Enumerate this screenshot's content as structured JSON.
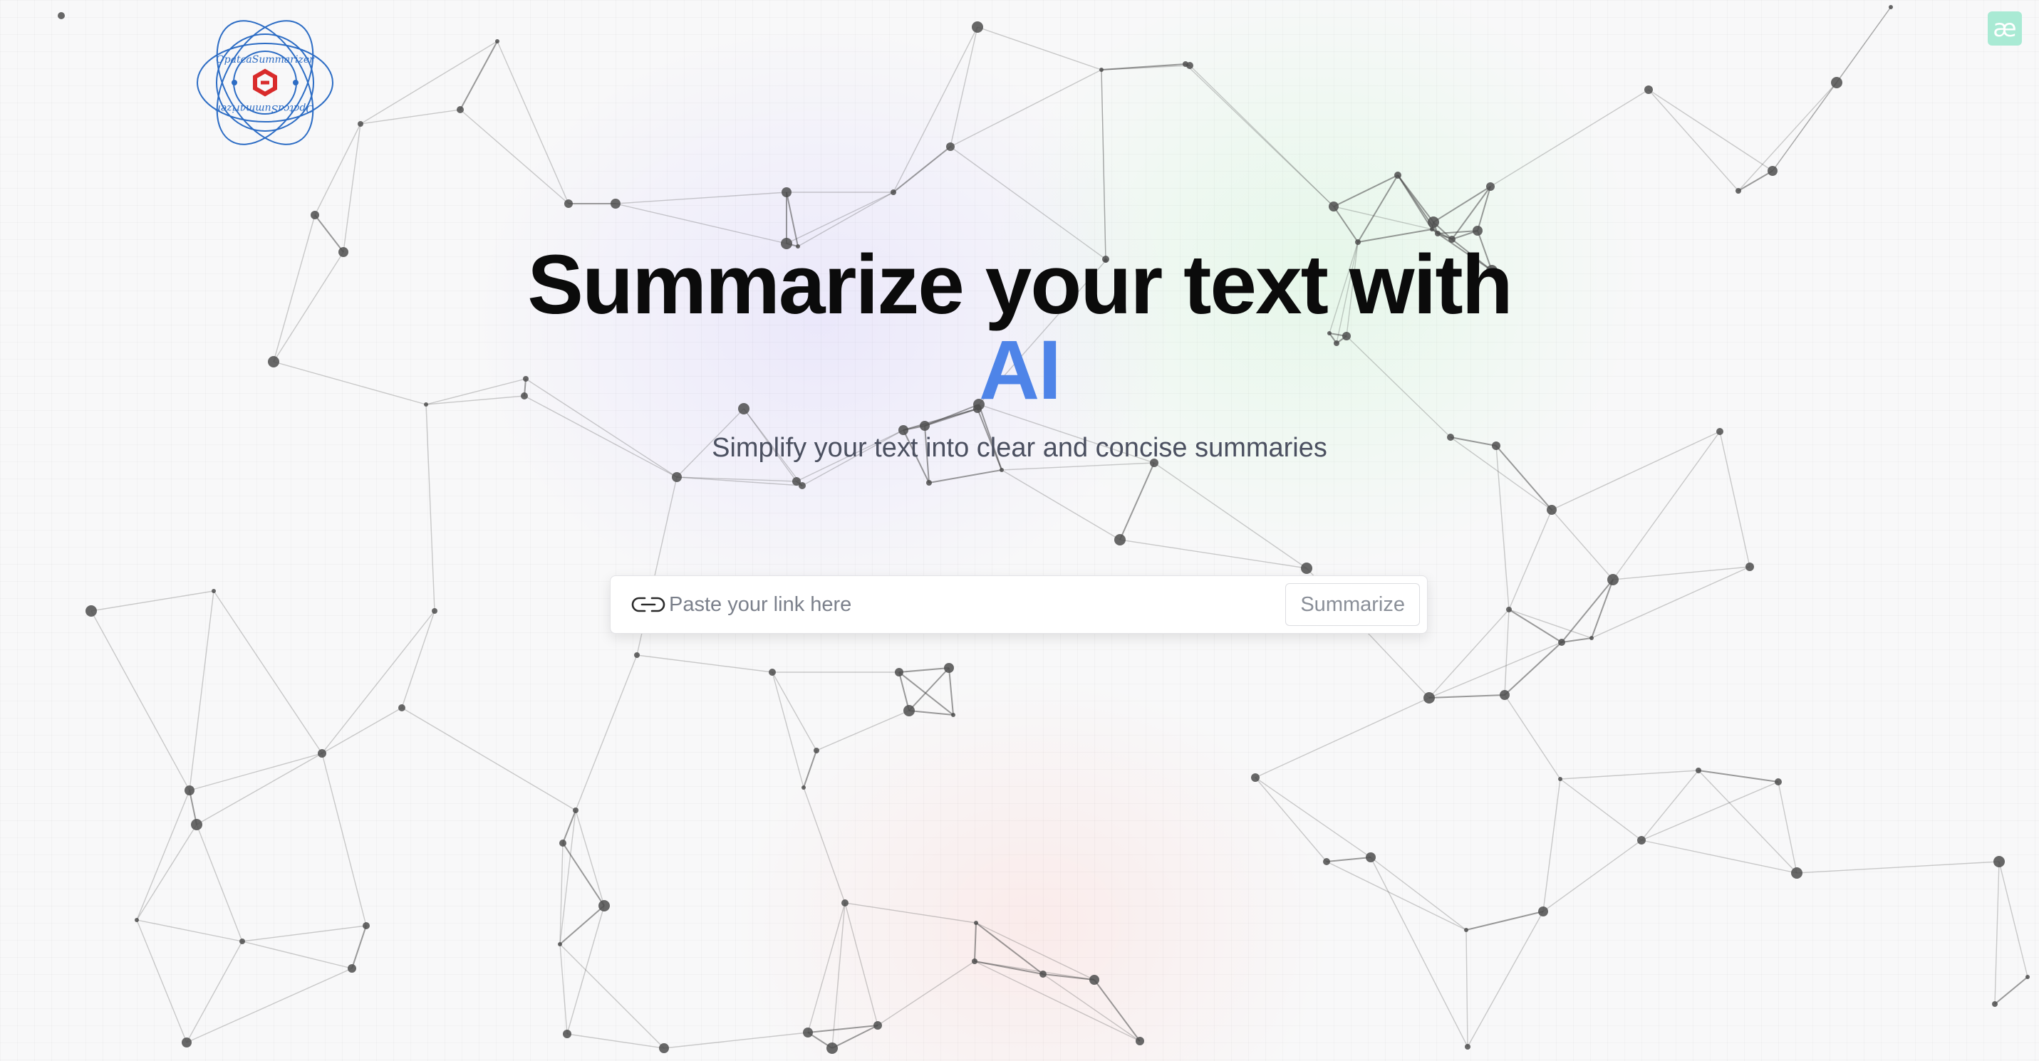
{
  "brand": {
    "logo_icon": "brain-network-logo",
    "logo_ring_text": "OpatcaSummarizer",
    "logo_colors": {
      "ring": "#2c6cc4",
      "mark": "#d92b2b"
    },
    "corner_badge": "æ",
    "corner_badge_color": "#a9ead4"
  },
  "hero": {
    "title": "Summarize your text with",
    "title_accent": "AI",
    "accent_color": "#4e84e8",
    "subtitle": "Simplify your text into clear and concise summaries"
  },
  "search": {
    "icon": "link-icon",
    "placeholder": "Paste your link here",
    "value": "",
    "button_label": "Summarize"
  },
  "background": {
    "decoration": "particle-network"
  }
}
